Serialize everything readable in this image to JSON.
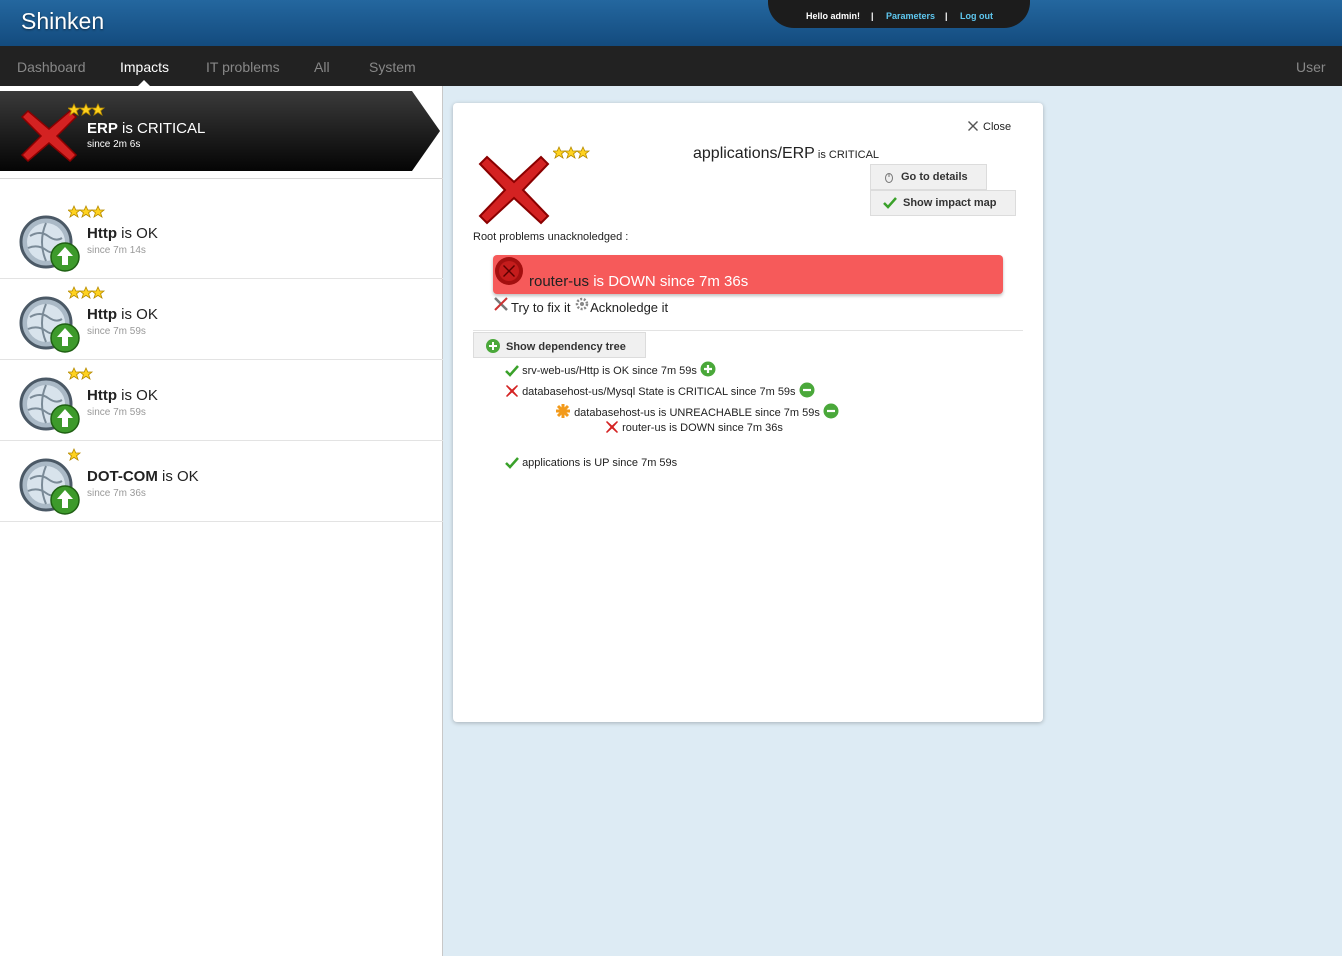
{
  "header": {
    "brand": "Shinken",
    "hello": "Hello admin!",
    "separator": "|",
    "parameters": "Parameters",
    "logout": "Log out"
  },
  "nav": {
    "items": [
      "Dashboard",
      "Impacts",
      "IT problems",
      "All",
      "System"
    ],
    "active": "Impacts",
    "user": "User"
  },
  "selected_impact": {
    "name": "ERP",
    "state_text": " is CRITICAL",
    "since": "since 2m 6s",
    "stars": 3,
    "icon": "critical-x-icon"
  },
  "impacts": [
    {
      "name": "Http",
      "state_text": " is OK",
      "since": "since 7m 14s",
      "stars": 3,
      "icon": "globe-up-icon"
    },
    {
      "name": "Http",
      "state_text": " is OK",
      "since": "since 7m 59s",
      "stars": 3,
      "icon": "globe-up-icon"
    },
    {
      "name": "Http",
      "state_text": " is OK",
      "since": "since 7m 59s",
      "stars": 2,
      "icon": "globe-up-icon"
    },
    {
      "name": "DOT-COM",
      "state_text": " is OK",
      "since": "since 7m 36s",
      "stars": 1,
      "icon": "globe-up-icon"
    }
  ],
  "detail": {
    "close": "Close",
    "title_name": "applications/ERP",
    "title_state": " is CRITICAL",
    "stars": 3,
    "go_to_details": "Go to details",
    "show_impact_map": "Show impact map",
    "root_label": "Root problems unacknoledged :",
    "root_problem": {
      "name": "router-us",
      "state_text": " is DOWN since 7m 36s"
    },
    "try_fix": "Try to fix it",
    "acknowledge": "Acknoledge it",
    "show_dependency_tree": "Show dependency tree",
    "tree": [
      {
        "name": "srv-web-us/Http",
        "text": " is OK since 7m 59s",
        "status": "ok",
        "toggle": "expand"
      },
      {
        "name": "databasehost-us/Mysql State",
        "text": " is CRITICAL since 7m 59s",
        "status": "critical",
        "toggle": "collapse"
      },
      {
        "name": "databasehost-us",
        "text": " is UNREACHABLE since 7m 59s",
        "status": "unreachable",
        "toggle": "collapse"
      },
      {
        "name": "router-us",
        "text": " is DOWN since 7m 36s",
        "status": "down",
        "toggle": ""
      },
      {
        "name": "applications",
        "text": " is UP since 7m 59s",
        "status": "ok",
        "toggle": ""
      }
    ]
  },
  "colors": {
    "header_top": "#24679f",
    "nav_bg": "#222222",
    "root_problem_bg": "#f65a5a",
    "link_blue": "#5fc8f0",
    "background": "#ddebf4"
  }
}
